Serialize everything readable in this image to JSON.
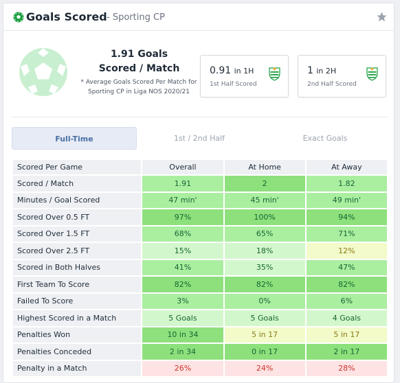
{
  "header": {
    "title": "Goals Scored",
    "subtitle": "- Sporting CP"
  },
  "summary": {
    "main_line1": "1.91 Goals",
    "main_line2": "Scored / Match",
    "note": "* Average Goals Scored Per Match for Sporting CP in Liga NOS 2020/21",
    "first_half": {
      "value": "0.91",
      "unit": "in 1H",
      "label": "1st Half Scored"
    },
    "second_half": {
      "value": "1",
      "unit": "in 2H",
      "label": "2nd Half Scored"
    }
  },
  "tabs": [
    "Full-Time",
    "1st / 2nd Half",
    "Exact Goals"
  ],
  "table": {
    "headers": [
      "Scored Per Game",
      "Overall",
      "At Home",
      "At Away"
    ],
    "rows": [
      {
        "label": "Scored / Match",
        "cells": [
          [
            "1.91",
            "g2"
          ],
          [
            "2",
            "g1"
          ],
          [
            "1.82",
            "g2"
          ]
        ]
      },
      {
        "label": "Minutes / Goal Scored",
        "cells": [
          [
            "47 min'",
            "g2"
          ],
          [
            "45 min'",
            "g2"
          ],
          [
            "49 min'",
            "g2"
          ]
        ]
      },
      {
        "label": "Scored Over 0.5 FT",
        "cells": [
          [
            "97%",
            "g1"
          ],
          [
            "100%",
            "g1"
          ],
          [
            "94%",
            "g1"
          ]
        ]
      },
      {
        "label": "Scored Over 1.5 FT",
        "cells": [
          [
            "68%",
            "g2"
          ],
          [
            "65%",
            "g2"
          ],
          [
            "71%",
            "g2"
          ]
        ]
      },
      {
        "label": "Scored Over 2.5 FT",
        "cells": [
          [
            "15%",
            "g3"
          ],
          [
            "18%",
            "g3"
          ],
          [
            "12%",
            "y1"
          ]
        ]
      },
      {
        "label": "Scored in Both Halves",
        "cells": [
          [
            "41%",
            "g2"
          ],
          [
            "35%",
            "g3"
          ],
          [
            "47%",
            "g2"
          ]
        ]
      },
      {
        "label": "First Team To Score",
        "cells": [
          [
            "82%",
            "g1"
          ],
          [
            "82%",
            "g1"
          ],
          [
            "82%",
            "g1"
          ]
        ]
      },
      {
        "label": "Failed To Score",
        "cells": [
          [
            "3%",
            "g2"
          ],
          [
            "0%",
            "g2"
          ],
          [
            "6%",
            "g2"
          ]
        ]
      },
      {
        "label": "Highest Scored in a Match",
        "cells": [
          [
            "5 Goals",
            "g3"
          ],
          [
            "5 Goals",
            "g3"
          ],
          [
            "4 Goals",
            "g3"
          ]
        ]
      },
      {
        "label": "Penalties Won",
        "cells": [
          [
            "10 in 34",
            "g1"
          ],
          [
            "5 in 17",
            "y1"
          ],
          [
            "5 in 17",
            "y1"
          ]
        ]
      },
      {
        "label": "Penalties Conceded",
        "cells": [
          [
            "2 in 34",
            "g1"
          ],
          [
            "0 in 17",
            "g1"
          ],
          [
            "2 in 17",
            "g1"
          ]
        ]
      },
      {
        "label": "Penalty in a Match",
        "cells": [
          [
            "26%",
            "r1"
          ],
          [
            "24%",
            "r1"
          ],
          [
            "28%",
            "r1"
          ]
        ]
      }
    ]
  },
  "colors": {
    "brand_green": "#1a9e3f",
    "active_tab_text": "#4a6fa5"
  },
  "icons": [
    "soccer-ball-icon",
    "star-icon",
    "sporting-crest-icon"
  ]
}
